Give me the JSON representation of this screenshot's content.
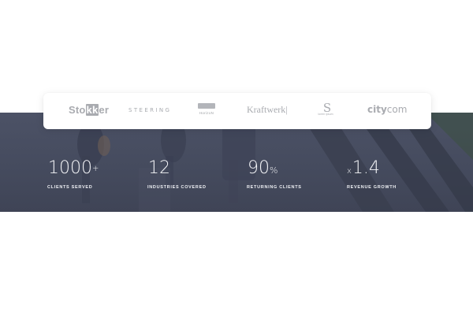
{
  "logos": {
    "stokker_a": "Sto",
    "stokker_b": "kk",
    "stokker_c": "er",
    "steering": "STEERING",
    "horizon": "HorizoN",
    "kraftwerk": "Kraftwerk|",
    "ss_mark": "S",
    "ss_sub": "lorem ipsum",
    "citycom_a": "city",
    "citycom_b": "com",
    "color": "#a9abb0"
  },
  "stats": [
    {
      "prefix": "",
      "value": "1000",
      "suffix": "+",
      "label": "CLIENTS SERVED"
    },
    {
      "prefix": "",
      "value": "12",
      "suffix": "",
      "label": "INDUSTRIES COVERED"
    },
    {
      "prefix": "",
      "value": "90",
      "suffix": "%",
      "label": "RETURNING CLIENTS"
    },
    {
      "prefix": "x",
      "value": "1.4",
      "suffix": "",
      "label": "REVENUE GROWTH"
    }
  ],
  "colors": {
    "hero_overlay": "#474c60",
    "card_bg": "#ffffff",
    "stat_text": "#ffffff"
  }
}
